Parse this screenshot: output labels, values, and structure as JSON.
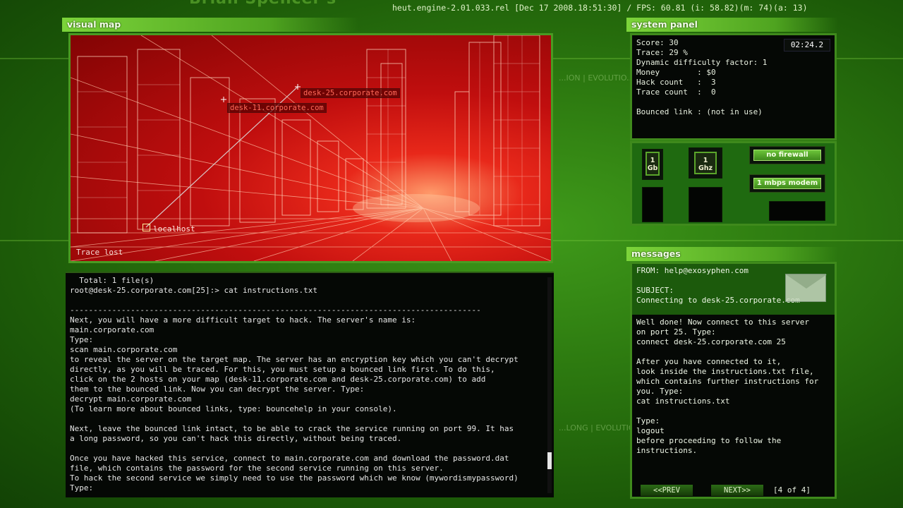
{
  "background": {
    "title": "Brian Spencer's",
    "watermarks": [
      "...ION | EVOLUTIO...",
      "...LONG | EVOLUTIO..."
    ]
  },
  "top_info": "heut.engine-2.01.033.rel [Dec 17 2008.18:51:30] / FPS: 60.81 (i: 58.82)(m:  74)(a: 13)",
  "visual_map": {
    "title": "visual map",
    "hosts": [
      "desk-25.corporate.com",
      "desk-11.corporate.com"
    ],
    "localhost": "localhost",
    "status": "Trace lost"
  },
  "console": {
    "lines": [
      "  Total: 1 file(s)",
      "root@desk-25.corporate.com[25]:> cat instructions.txt",
      "",
      "----------------------------------------------------------------------------------------",
      "Next, you will have a more difficult target to hack. The server's name is:",
      "main.corporate.com",
      "Type:",
      "scan main.corporate.com",
      "to reveal the server on the target map. The server has an encryption key which you can't decrypt",
      "directly, as you will be traced. For this, you must setup a bounced link first. To do this,",
      "click on the 2 hosts on your map (desk-11.corporate.com and desk-25.corporate.com) to add",
      "them to the bounced link. Now you can decrypt the server. Type:",
      "decrypt main.corporate.com",
      "(To learn more about bounced links, type: bouncehelp in your console).",
      "",
      "Next, leave the bounced link intact, to be able to crack the service running on port 99. It has",
      "a long password, so you can't hack this directly, without being traced.",
      "",
      "Once you have hacked this service, connect to main.corporate.com and download the password.dat",
      "file, which contains the password for the second service running on this server.",
      "To hack the second service we simply need to use the password which we know (mywordismypassword)",
      "Type:"
    ]
  },
  "system_panel": {
    "title": "system panel",
    "timer": "02:24.2",
    "lines": [
      "Score: 30",
      "Trace: 29 %",
      "Dynamic difficulty factor: 1",
      "Money        : $0",
      "Hack count   :  3",
      "Trace count  :  0",
      "",
      "Bounced link : (not in use)"
    ],
    "hardware": {
      "memory": "1\nGb",
      "cpu": "1\nGhz",
      "firewall": "no firewall",
      "modem": "1 mbps modem"
    }
  },
  "messages": {
    "title": "messages",
    "from": "FROM: help@exosyphen.com",
    "subject_label": "SUBJECT:",
    "subject": "Connecting to desk-25.corporate.com",
    "body": [
      "Well done! Now connect to this server",
      "on port 25. Type:",
      "connect desk-25.corporate.com 25",
      "",
      "After you have connected to it,",
      "look inside the instructions.txt file,",
      "which contains further instructions for",
      "you. Type:",
      "cat instructions.txt",
      "",
      "Type:",
      "logout",
      "before proceeding to follow the",
      "instructions."
    ],
    "prev": "<<PREV",
    "next": "NEXT>>",
    "page": "[4 of 4]"
  },
  "colors": {
    "panel_green": "#3f8a1c",
    "header_green": "#7cd43a",
    "map_red": "#c00e0e"
  }
}
